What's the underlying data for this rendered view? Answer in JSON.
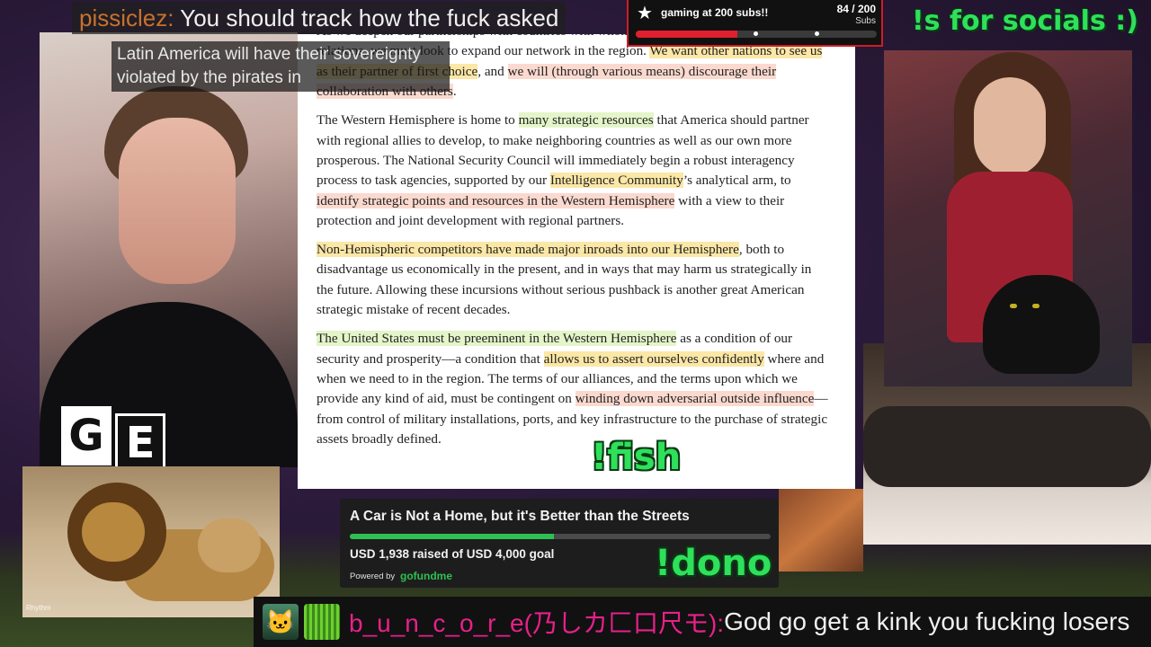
{
  "top_chat": {
    "user": "pissiclez:",
    "message": " You should track how the fuck asked"
  },
  "caption": "Latin America will have their sovereignty violated by the pirates in",
  "sub_goal": {
    "star_icon": "star-icon",
    "title": "gaming at 200 subs!!",
    "count": "84 / 200",
    "unit": "Subs",
    "current": 84,
    "target": 200
  },
  "socials": "!s for socials :)",
  "logo": {
    "g": "G",
    "e": "E"
  },
  "document": {
    "paragraphs": [
      [
        {
          "t": "As we deepen our partnerships with countries with whom America presently has strong relations, we must look to expand our network in the region. ",
          "h": ""
        },
        {
          "t": "We want other nations to see us as their partner of first choice",
          "h": "y"
        },
        {
          "t": ", and ",
          "h": ""
        },
        {
          "t": "we will (through various means) discourage their collaboration with others",
          "h": "r"
        },
        {
          "t": ".",
          "h": ""
        }
      ],
      [
        {
          "t": "The Western Hemisphere is home to ",
          "h": ""
        },
        {
          "t": "many strategic resources",
          "h": "g"
        },
        {
          "t": " that America should partner with regional allies to develop, to make neighboring countries as well as our own more prosperous. The National Security Council will immediately begin a robust interagency process to task agencies, supported by our ",
          "h": ""
        },
        {
          "t": "Intelligence Community",
          "h": "y"
        },
        {
          "t": "’s analytical arm, to ",
          "h": ""
        },
        {
          "t": "identify strategic points and resources in the Western Hemisphere",
          "h": "r"
        },
        {
          "t": " with a view to their protection and joint development with regional partners.",
          "h": ""
        }
      ],
      [
        {
          "t": "Non-Hemispheric competitors have made major inroads into our Hemisphere",
          "h": "y"
        },
        {
          "t": ", both to disadvantage us economically in the present, and in ways that may harm us strategically in the future. Allowing these incursions without serious pushback is another great American strategic mistake of recent decades.",
          "h": ""
        }
      ],
      [
        {
          "t": "The United States must be preeminent in the Western Hemisphere",
          "h": "g"
        },
        {
          "t": " as a condition of our security and prosperity—a condition that ",
          "h": ""
        },
        {
          "t": "allows us to assert ourselves confidently",
          "h": "y"
        },
        {
          "t": " where and when we need to in the region. The terms of our alliances, and the terms upon which we provide any kind of aid, must be contingent on ",
          "h": ""
        },
        {
          "t": "winding down adversarial outside influence",
          "h": "r"
        },
        {
          "t": "—from control of military installations, ports, and key infrastructure to the purchase of strategic assets broadly defined.",
          "h": ""
        }
      ]
    ]
  },
  "commands": {
    "fish": "!fish",
    "dono": "!dono"
  },
  "gofundme": {
    "title": "A Car is Not a Home, but it's Better than the Streets",
    "raised_text": "USD 1,938 raised of USD 4,000 goal",
    "raised": 1938,
    "goal": 4000,
    "powered_by": "Powered by",
    "brand": "gofundme"
  },
  "lion_watermark": "Rhythm",
  "bottom_chat": {
    "user": "b_u_n_c_o_r_e(乃しカ匚口尺モ): ",
    "message": "God go get a kink you fucking losers"
  }
}
